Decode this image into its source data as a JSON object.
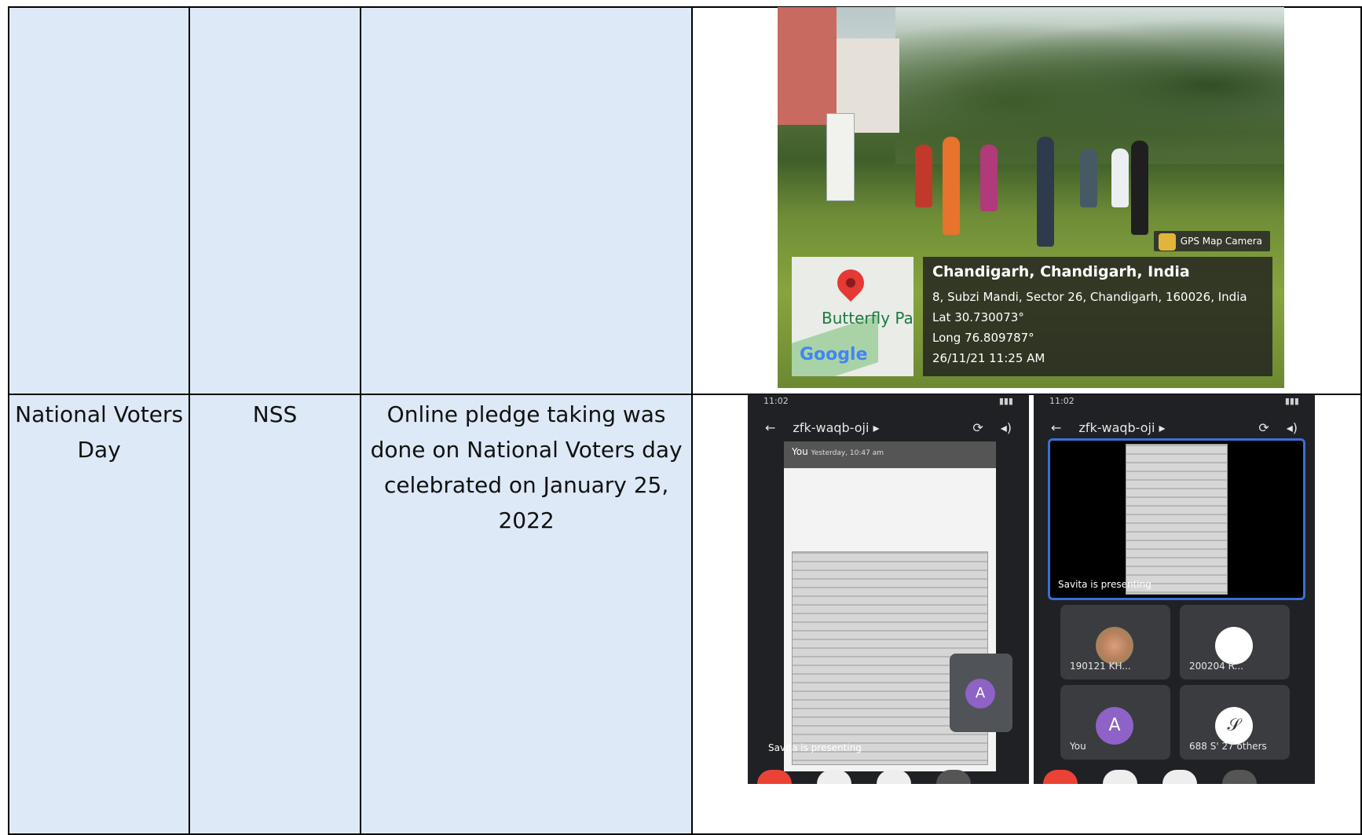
{
  "row2": {
    "event": "National Voters Day",
    "organizer": "NSS",
    "description": "Online pledge taking was done on National Voters day celebrated on January 25, 2022"
  },
  "photo1": {
    "gps_badge": "GPS Map Camera",
    "map_label": "Butterfly Par",
    "map_brand": "Google",
    "title": "Chandigarh, Chandigarh, India",
    "address": "8, Subzi Mandi, Sector 26, Chandigarh, 160026, India",
    "lat": "Lat 30.730073°",
    "long": "Long 76.809787°",
    "datetime": "26/11/21 11:25 AM"
  },
  "phone_left": {
    "time": "11:02",
    "meeting_code": "zfk-waqb-oji ▸",
    "inner_title": "You",
    "inner_sub": "Yesterday, 10:47 am",
    "tile_initial": "A",
    "caption": "Savita is presenting"
  },
  "phone_right": {
    "time": "11:02",
    "meeting_code": "zfk-waqb-oji ▸",
    "caption": "Savita is presenting",
    "tiles": [
      {
        "name": "190121 KH...",
        "initial": ""
      },
      {
        "name": "200204 R...",
        "initial": ""
      },
      {
        "name": "You",
        "initial": "A"
      },
      {
        "name": "688 S' 27 others",
        "initial": "𝒮"
      }
    ]
  }
}
